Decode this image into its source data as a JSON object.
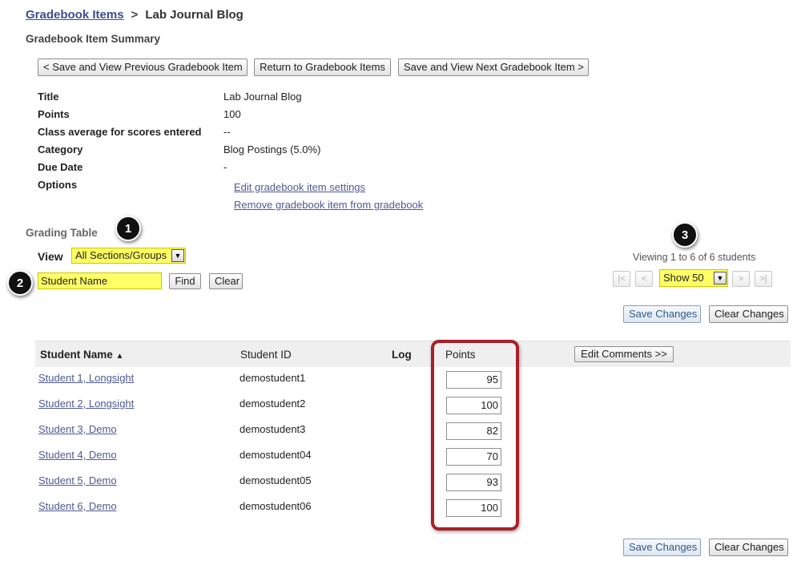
{
  "breadcrumb": {
    "parent": "Gradebook Items",
    "separator": ">",
    "current": "Lab Journal Blog"
  },
  "summary": {
    "heading": "Gradebook Item Summary",
    "buttons": {
      "prev": "< Save and View Previous Gradebook Item",
      "back": "Return to Gradebook Items",
      "next": "Save and View Next Gradebook Item >"
    },
    "fields": {
      "title_label": "Title",
      "title_value": "Lab Journal Blog",
      "points_label": "Points",
      "points_value": "100",
      "average_label": "Class average for scores entered",
      "average_value": "--",
      "category_label": "Category",
      "category_value": "Blog Postings (5.0%)",
      "due_label": "Due Date",
      "due_value": "-",
      "options_label": "Options"
    },
    "options": {
      "edit": "Edit gradebook item settings",
      "remove": "Remove gradebook item from gradebook"
    }
  },
  "grading": {
    "heading": "Grading Table",
    "view_label": "View",
    "view_selected": "All Sections/Groups",
    "search_value": "Student Name",
    "find_label": "Find",
    "clear_label": "Clear",
    "viewing_text": "Viewing 1 to 6 of 6 students",
    "page_size": "Show 50",
    "pager": {
      "first": "|<",
      "prev": "<",
      "next": ">",
      "last": ">|"
    },
    "save_label": "Save Changes",
    "clear_changes_label": "Clear Changes",
    "columns": {
      "name": "Student Name",
      "sort_indicator": "▲",
      "id": "Student ID",
      "log": "Log",
      "points": "Points",
      "comments_button": "Edit Comments >>"
    },
    "rows": [
      {
        "name": "Student 1, Longsight",
        "id": "demostudent1",
        "points": "95"
      },
      {
        "name": "Student 2, Longsight",
        "id": "demostudent2",
        "points": "100"
      },
      {
        "name": "Student 3, Demo",
        "id": "demostudent3",
        "points": "82"
      },
      {
        "name": "Student 4, Demo",
        "id": "demostudent04",
        "points": "70"
      },
      {
        "name": "Student 5, Demo",
        "id": "demostudent05",
        "points": "93"
      },
      {
        "name": "Student 6, Demo",
        "id": "demostudent06",
        "points": "100"
      }
    ]
  },
  "callouts": {
    "one": "1",
    "two": "2",
    "three": "3"
  },
  "colors": {
    "highlight": "#ffff66",
    "callout_border": "#a8202a",
    "link": "#4d5a91"
  }
}
